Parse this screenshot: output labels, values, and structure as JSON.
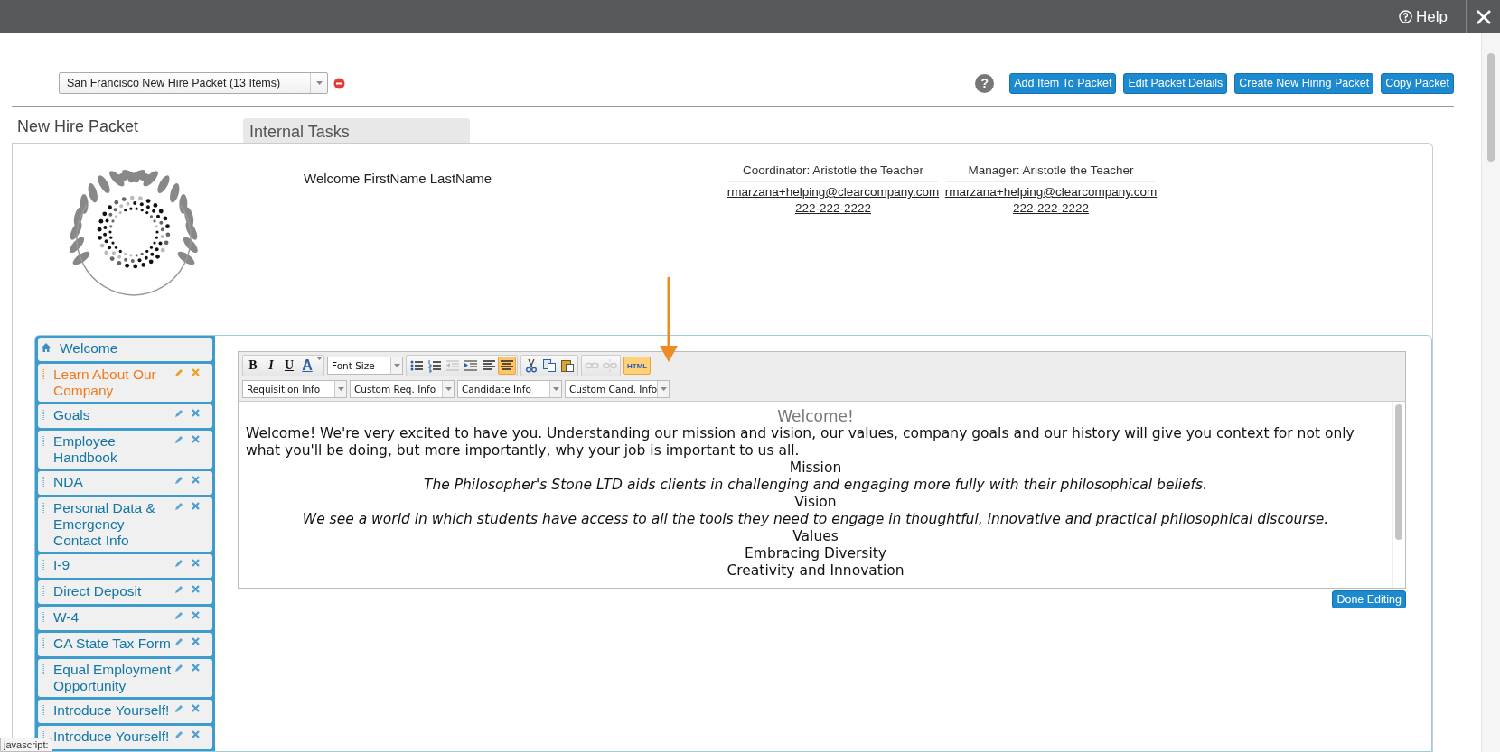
{
  "top_bar": {
    "help": "Help"
  },
  "packet_select": {
    "value": "San Francisco New Hire Packet (13 Items)"
  },
  "help_badge": "?",
  "buttons": [
    "Add Item To Packet",
    "Edit Packet Details",
    "Create New Hiring Packet",
    "Copy Packet"
  ],
  "title": "New Hire Packet",
  "tabs": [
    {
      "label": "Internal Tasks",
      "selected": true
    }
  ],
  "welcome_text": "Welcome FirstName LastName",
  "contacts": [
    {
      "title": "Coordinator: Aristotle the Teacher",
      "email": "rmarzana+helping@clearcompany.com",
      "phone": "222-222-2222"
    },
    {
      "title": "Manager: Aristotle the Teacher",
      "email": "rmarzana+helping@clearcompany.com",
      "phone": "222-222-2222"
    }
  ],
  "sidebar_items": [
    {
      "label": "Welcome",
      "kind": "home",
      "selected": false
    },
    {
      "label": "Learn About Our Company",
      "kind": "item",
      "selected": true
    },
    {
      "label": "Goals",
      "kind": "item",
      "selected": false
    },
    {
      "label": "Employee Handbook",
      "kind": "item",
      "selected": false
    },
    {
      "label": "NDA",
      "kind": "item",
      "selected": false
    },
    {
      "label": "Personal Data & Emergency Contact Info",
      "kind": "item",
      "selected": false
    },
    {
      "label": "I-9",
      "kind": "item",
      "selected": false
    },
    {
      "label": "Direct Deposit",
      "kind": "item",
      "selected": false
    },
    {
      "label": "W-4",
      "kind": "item",
      "selected": false
    },
    {
      "label": "CA State Tax Form",
      "kind": "item",
      "selected": false
    },
    {
      "label": "Equal Employment Opportunity",
      "kind": "item",
      "selected": false
    },
    {
      "label": "Introduce Yourself!",
      "kind": "item",
      "selected": false
    },
    {
      "label": "Introduce Yourself!",
      "kind": "item",
      "selected": false
    }
  ],
  "editor": {
    "format_buttons": [
      {
        "label": "B",
        "kind": "bold"
      },
      {
        "label": "I",
        "kind": "italic"
      },
      {
        "label": "U",
        "kind": "underline"
      },
      {
        "label": "A",
        "kind": "color"
      }
    ],
    "font_size": "Font Size",
    "tool_buttons": [
      {
        "kind": "bullet-list",
        "on": false,
        "disabled": false
      },
      {
        "kind": "numbered-list",
        "on": false,
        "disabled": false
      },
      {
        "kind": "outdent",
        "on": false,
        "disabled": true
      },
      {
        "kind": "indent",
        "on": false,
        "disabled": false
      },
      {
        "kind": "align-left",
        "on": false,
        "disabled": false
      },
      {
        "kind": "align-center",
        "on": true,
        "disabled": false
      },
      {
        "kind": "cut",
        "on": false,
        "disabled": false
      },
      {
        "kind": "copy",
        "on": false,
        "disabled": false
      },
      {
        "kind": "paste",
        "on": false,
        "disabled": false
      },
      {
        "kind": "link",
        "on": false,
        "disabled": true
      },
      {
        "kind": "unlink",
        "on": false,
        "disabled": true
      }
    ],
    "html_button": {
      "label": "HTML",
      "on": true
    },
    "insert_dropdowns": [
      "Requisition Info",
      "Custom Req. Info",
      "Candidate Info",
      "Custom Cand. Info"
    ],
    "content": [
      {
        "text": "Welcome!",
        "kind": "heading"
      },
      {
        "text": "Welcome! We're very excited to have you. Understanding our mission and vision, our values, company goals and our history will give you context for not only what you'll be doing, but more importantly, why your job is important to us all.",
        "kind": "paragraph"
      },
      {
        "text": "Mission",
        "kind": "center"
      },
      {
        "text": "The Philosopher's Stone LTD aids clients in challenging and engaging more fully with their philosophical beliefs.",
        "kind": "italic"
      },
      {
        "text": "Vision",
        "kind": "center"
      },
      {
        "text": "We see a world in which students have access to all the tools they need to engage in thoughtful, innovative and practical philosophical discourse.",
        "kind": "italic"
      },
      {
        "text": "Values",
        "kind": "center"
      },
      {
        "text": "Embracing Diversity",
        "kind": "center"
      },
      {
        "text": "Creativity and Innovation",
        "kind": "center"
      }
    ]
  },
  "done_button": "Done Editing",
  "status_tooltip": "javascript:"
}
